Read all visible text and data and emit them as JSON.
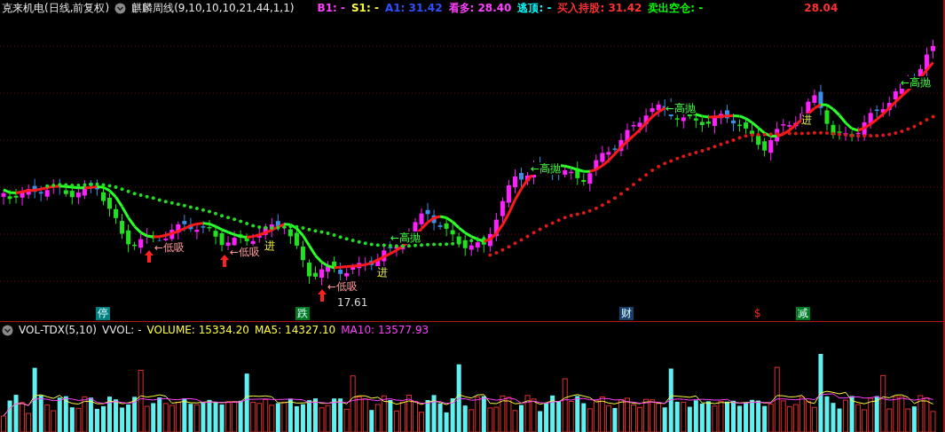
{
  "header": {
    "stock": "克来机电(日线,前复权)",
    "indicator": "麒麟周线(9,10,10,10,21,44,1,1)",
    "readings": [
      {
        "text": "B1: -",
        "color": "#ff40ff"
      },
      {
        "text": "S1: -",
        "color": "#ffff40"
      },
      {
        "text": "A1: 31.42",
        "color": "#3050ff"
      },
      {
        "text": "看多: 28.40",
        "color": "#ff40ff"
      },
      {
        "text": "逃顶: -",
        "color": "#00ffff"
      },
      {
        "text": "买入持股: 31.42",
        "color": "#ff3030"
      },
      {
        "text": "卖出空仓: -",
        "color": "#00ff00"
      },
      {
        "text": "28.04",
        "color": "#ff3030"
      }
    ]
  },
  "price_panel": {
    "annotations": [
      {
        "kind": "low-buy",
        "text": "←低吸"
      },
      {
        "kind": "low-buy",
        "text": "←低吸"
      },
      {
        "kind": "low-buy",
        "text": "←低吸"
      },
      {
        "kind": "price",
        "text": "17.61"
      },
      {
        "kind": "enter",
        "text": "进"
      },
      {
        "kind": "enter",
        "text": "进"
      },
      {
        "kind": "enter",
        "text": "进"
      },
      {
        "kind": "high-sell",
        "text": "←高抛"
      },
      {
        "kind": "high-sell",
        "text": "←高抛"
      },
      {
        "kind": "high-sell",
        "text": "←高抛"
      },
      {
        "kind": "high-sell",
        "text": "←高抛"
      }
    ],
    "markers": [
      {
        "text": "停",
        "kind": "chip",
        "color": "#008080"
      },
      {
        "text": "跌",
        "kind": "chip",
        "color": "#007a20"
      },
      {
        "text": "财",
        "kind": "chip",
        "color": "#1a3f6a"
      },
      {
        "text": "$",
        "kind": "glyph",
        "color": "#ff2020"
      },
      {
        "text": "减",
        "kind": "chip",
        "color": "#007a20"
      }
    ]
  },
  "volume_panel": {
    "title": "VOL-TDX(5,10)",
    "readings": [
      {
        "text": "VVOL: -",
        "color": "#e0e0e0"
      },
      {
        "text": "VOLUME: 15334.20",
        "color": "#ffff40"
      },
      {
        "text": "MA5: 14327.10",
        "color": "#ffff40"
      },
      {
        "text": "MA10: 13577.93",
        "color": "#ff40ff"
      }
    ]
  }
}
